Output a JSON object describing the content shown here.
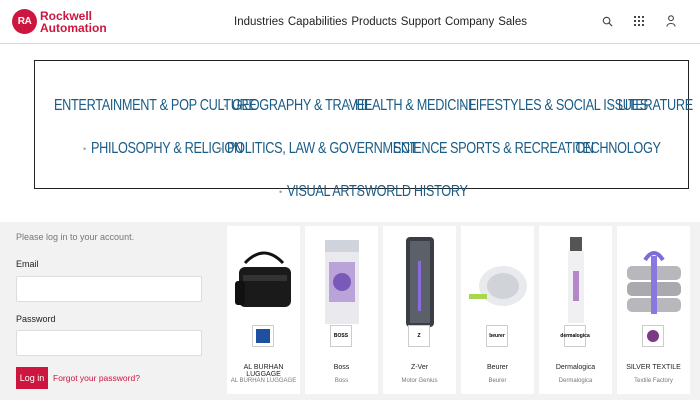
{
  "header": {
    "logo_mark": "RA",
    "logo_line1": "Rockwell",
    "logo_line2": "Automation",
    "nav": [
      "Industries",
      "Capabilities",
      "Products",
      "Support",
      "Company",
      "Sales"
    ],
    "icons": [
      "search-icon",
      "grid-icon",
      "user-icon"
    ]
  },
  "categories": {
    "row1": [
      "ENTERTAINMENT & POP CULTURE",
      "GEOGRAPHY & TRAVEL",
      "HEALTH & MEDICINE",
      "LIFESTYLES & SOCIAL ISSUES",
      "LITERATURE"
    ],
    "row2": [
      "PHILOSOPHY & RELIGION",
      "POLITICS, LAW & GOVERNMENT",
      "SCIENCE",
      "SPORTS & RECREATION",
      "TECHNOLOGY"
    ],
    "row3": [
      "VISUAL ARTS",
      "WORLD HISTORY"
    ],
    "color": "#1a5c86"
  },
  "login": {
    "hint": "Please log in to your account.",
    "email_label": "Email",
    "email_value": "",
    "password_label": "Password",
    "password_value": "",
    "button": "Log in",
    "forgot": "Forgot your password?"
  },
  "products": [
    {
      "name": "AL BURHAN LUGGAGE",
      "sub": "AL BURHAN LUGGAGE",
      "logo": "luggage"
    },
    {
      "name": "Boss",
      "sub": "Boss",
      "logo": "BOSS"
    },
    {
      "name": "Z-Ver",
      "sub": "Motor Genius",
      "logo": "Z"
    },
    {
      "name": "Beurer",
      "sub": "Beurer",
      "logo": "beurer"
    },
    {
      "name": "Dermalogica",
      "sub": "Dermalogica",
      "logo": "dermalogica"
    },
    {
      "name": "SILVER TEXTILE",
      "sub": "Textile Factory",
      "logo": "ST"
    }
  ],
  "brand_color": "#cd163f"
}
